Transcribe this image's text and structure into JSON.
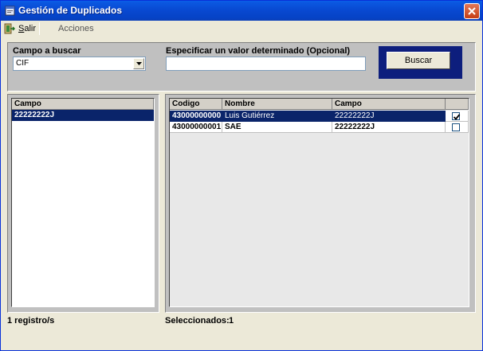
{
  "window": {
    "title": "Gestión de Duplicados"
  },
  "toolbar": {
    "salir_prefix": "S",
    "salir_rest": "alir",
    "acciones_label": "Acciones"
  },
  "search": {
    "field_label": "Campo a buscar",
    "field_value": "CIF",
    "value_label": "Especificar un valor determinado (Opcional)",
    "value_text": "",
    "button_label": "Buscar"
  },
  "left_grid": {
    "header": "Campo",
    "rows": [
      "22222222J"
    ]
  },
  "right_grid": {
    "headers": {
      "codigo": "Codigo",
      "nombre": "Nombre",
      "campo": "Campo"
    },
    "rows": [
      {
        "codigo": "43000000000",
        "nombre": "Luis Gutiérrez",
        "campo": "22222222J",
        "checked": true
      },
      {
        "codigo": "43000000001",
        "nombre": "SAE",
        "campo": "22222222J",
        "checked": false
      }
    ]
  },
  "status": {
    "registros": "1 registro/s",
    "seleccionados_label": "Seleccionados:",
    "seleccionados_count": "1"
  },
  "icons": {
    "window": "window-icon",
    "close": "close-icon",
    "salir": "exit-icon",
    "dropdown": "chevron-down-icon",
    "checkbox": "checkmark-icon"
  },
  "colors": {
    "title_bar": "#0848d0",
    "selection": "#0a246a",
    "button_frame": "#0d1e7d"
  }
}
